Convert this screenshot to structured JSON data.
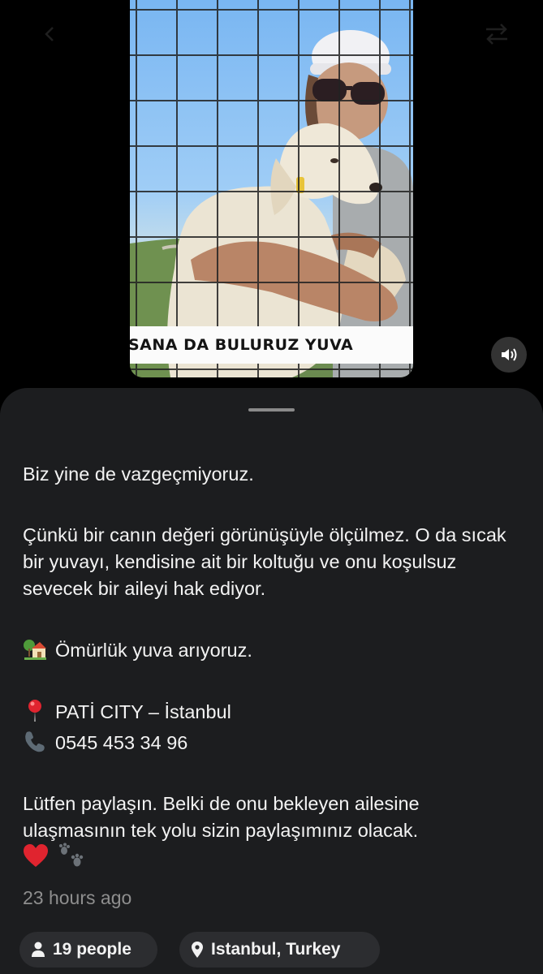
{
  "video": {
    "caption": "SANA DA BULURUZ YUVA"
  },
  "post": {
    "lines": [
      "Biz yine de vazgeçmiyoruz.",
      "Çünkü bir canın değeri görünüşüyle ölçülmez. O da sıcak bir yuvayı, kendisine ait bir koltuğu ve onu koşulsuz sevecek bir aileyi hak ediyor.",
      "Ömürlük yuva arıyoruz.",
      "PATİ CITY – İstanbul",
      "0545 453 34 96",
      "Lütfen paylaşın. Belki de onu bekleyen ailesine ulaşmasının tek yolu sizin paylaşımınız olacak."
    ],
    "icons": [
      "house-with-garden-icon",
      "round-pushpin-icon",
      "telephone-receiver-icon",
      "red-heart-icon",
      "paw-prints-icon"
    ],
    "timestamp": "23 hours ago"
  },
  "chips": {
    "people": "19 people",
    "location": "Istanbul, Turkey"
  },
  "colors": {
    "sheet_background": "#1c1d1f",
    "chip_background": "#2c2d30",
    "muted_text": "#8e8e8e",
    "heart": "#e0242f"
  }
}
